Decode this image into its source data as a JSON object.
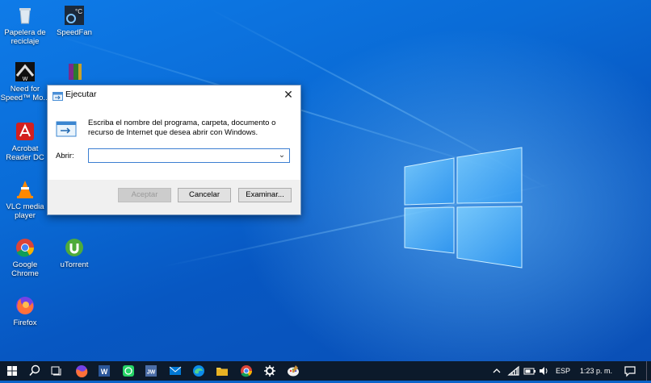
{
  "desktop_icons": [
    {
      "name": "recycle-bin",
      "label": "Papelera de reciclaje"
    },
    {
      "name": "speedfan",
      "label": "SpeedFan"
    },
    {
      "name": "need-for-speed",
      "label": "Need for Speed™ Mo..."
    },
    {
      "name": "winrar-archive",
      "label": ""
    },
    {
      "name": "acrobat-reader",
      "label": "Acrobat Reader DC"
    },
    {
      "name": "vlc",
      "label": "VLC media player"
    },
    {
      "name": "google-chrome",
      "label": "Google Chrome"
    },
    {
      "name": "utorrent",
      "label": "uTorrent"
    },
    {
      "name": "firefox",
      "label": "Firefox"
    }
  ],
  "run_dialog": {
    "title": "Ejecutar",
    "close_label": "✕",
    "description": "Escriba el nombre del programa, carpeta, documento o recurso de Internet que desea abrir con Windows.",
    "open_label": "Abrir:",
    "input_value": "",
    "accept_label": "Aceptar",
    "cancel_label": "Cancelar",
    "browse_label": "Examinar..."
  },
  "taskbar": {
    "language": "ESP",
    "time": "1:23 p. m."
  },
  "colors": {
    "taskbar_bg": "#0c1a2b",
    "dialog_border": "#6d8fb8",
    "input_border": "#3c7fd1"
  }
}
